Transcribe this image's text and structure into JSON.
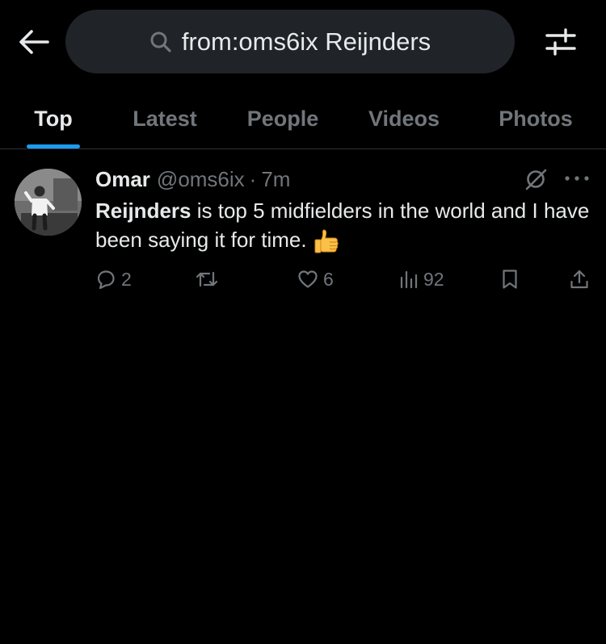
{
  "search": {
    "query": "from:oms6ix Reijnders"
  },
  "tabs": [
    {
      "label": "Top",
      "active": true
    },
    {
      "label": "Latest",
      "active": false
    },
    {
      "label": "People",
      "active": false
    },
    {
      "label": "Videos",
      "active": false
    },
    {
      "label": "Photos",
      "active": false
    }
  ],
  "post": {
    "author_name": "Omar",
    "handle": "@oms6ix",
    "separator": "·",
    "time": "7m",
    "text_bold": "Reijnders",
    "text_rest": " is top 5 midfielders in the world and I have been saying it for time.",
    "emoji": "thumbs-up",
    "replies": "2",
    "reposts": "",
    "likes": "6",
    "views": "92"
  },
  "colors": {
    "background": "#000000",
    "pill": "#202327",
    "text": "#e7e9ea",
    "muted": "#71767b",
    "accent": "#1d9bf0",
    "divider": "#2f3336"
  },
  "icons": [
    "back-arrow-icon",
    "search-icon",
    "filter-sliders-icon",
    "grok-icon",
    "more-icon",
    "reply-icon",
    "repost-icon",
    "like-icon",
    "views-icon",
    "bookmark-icon",
    "share-icon",
    "thumbs-up-emoji"
  ]
}
